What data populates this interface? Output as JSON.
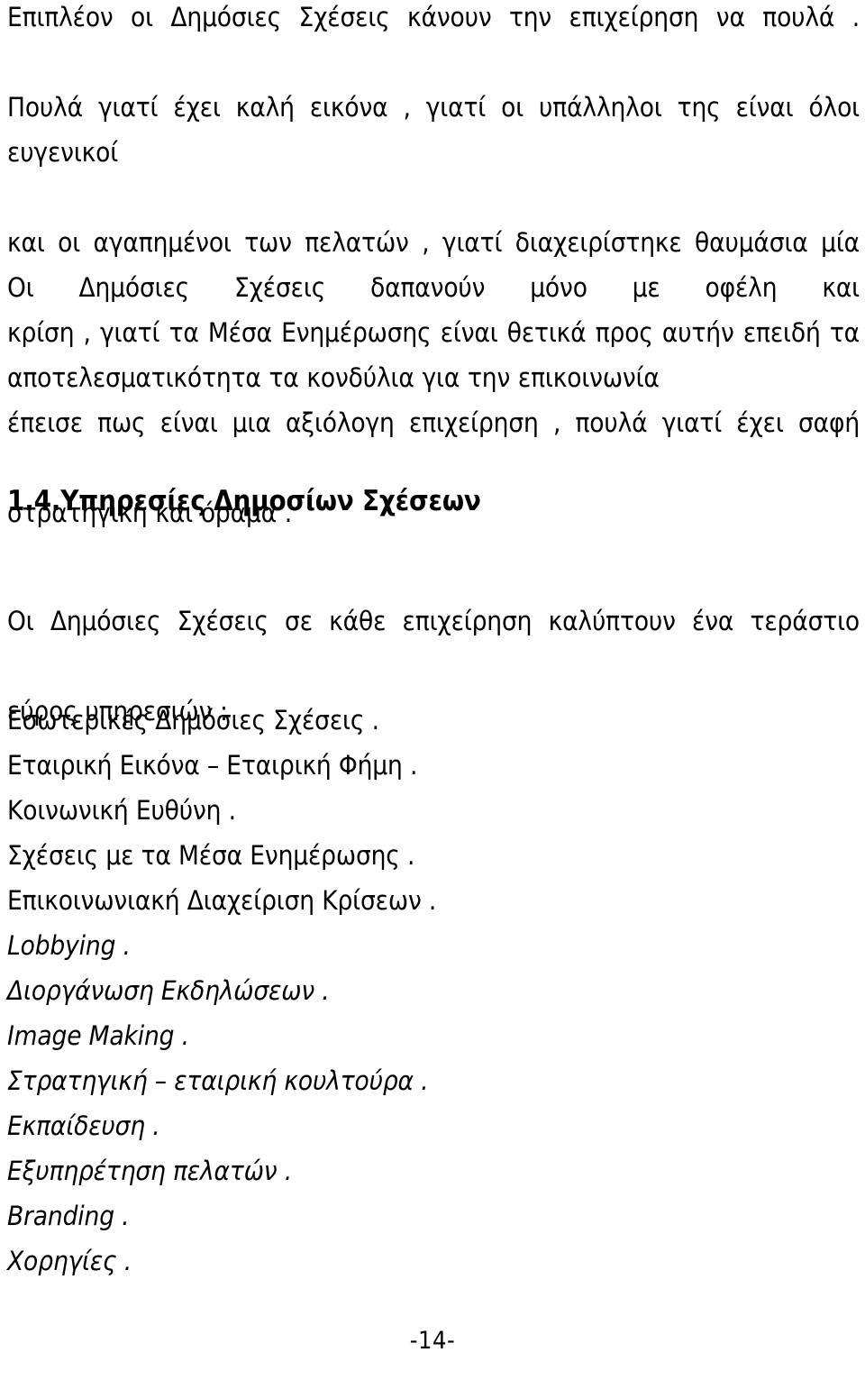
{
  "document": {
    "language": "el",
    "page_number_label": "-14-",
    "background_color": "#ffffff",
    "text_color": "#000000"
  },
  "paragraph_1": {
    "lines": [
      "Επιπλέον οι Δημόσιες Σχέσεις  κάνουν την επιχείρηση να πουλά .",
      "Πουλά γιατί έχει καλή εικόνα , γιατί οι υπάλληλοι της είναι όλοι ευγενικοί",
      "και οι αγαπημένοι των πελατών , γιατί διαχειρίστηκε θαυμάσια μία",
      "κρίση , γιατί τα Μέσα Ενημέρωσης είναι θετικά προς αυτήν επειδή τα",
      "έπεισε πως είναι μια αξιόλογη επιχείρηση , πουλά γιατί έχει σαφή",
      "στρατηγική  και όραμα ."
    ]
  },
  "paragraph_2": {
    "lines": [
      "Οι Δημόσιες Σχέσεις δαπανούν μόνο με οφέλη και",
      "αποτελεσματικότητα τα κονδύλια για την επικοινωνία"
    ]
  },
  "heading": {
    "number": "1.4.",
    "text": "Υπηρεσίες Δημοσίων Σχέσεων",
    "full": "1.4.Υπηρεσίες Δημοσίων Σχέσεων"
  },
  "intro": {
    "lines": [
      "Οι Δημόσιες Σχέσεις σε κάθε επιχείρηση καλύπτουν ένα τεράστιο",
      "εύρος υπηρεσιών :"
    ]
  },
  "services_list": [
    {
      "text": "Εσωτερικές Δημόσιες Σχέσεις .",
      "style": "normal"
    },
    {
      "text": "Εταιρική Εικόνα – Εταιρική Φήμη .",
      "style": "normal"
    },
    {
      "text": "Κοινωνική Ευθύνη .",
      "style": "normal"
    },
    {
      "text": "Σχέσεις με τα Μέσα Ενημέρωσης .",
      "style": "normal"
    },
    {
      "text": "Επικοινωνιακή Διαχείριση Κρίσεων .",
      "style": "normal"
    },
    {
      "text": "Lobbying .",
      "style": "italic"
    },
    {
      "text": "Διοργάνωση Εκδηλώσεων .",
      "style": "italic"
    },
    {
      "text": "Image Making .",
      "style": "italic"
    },
    {
      "text": "Στρατηγική – εταιρική κουλτούρα .",
      "style": "italic"
    },
    {
      "text": "Εκπαίδευση .",
      "style": "italic"
    },
    {
      "text": "Εξυπηρέτηση πελατών .",
      "style": "italic"
    },
    {
      "text": "Branding .",
      "style": "italic"
    },
    {
      "text": "Χορηγίες .",
      "style": "italic"
    }
  ]
}
